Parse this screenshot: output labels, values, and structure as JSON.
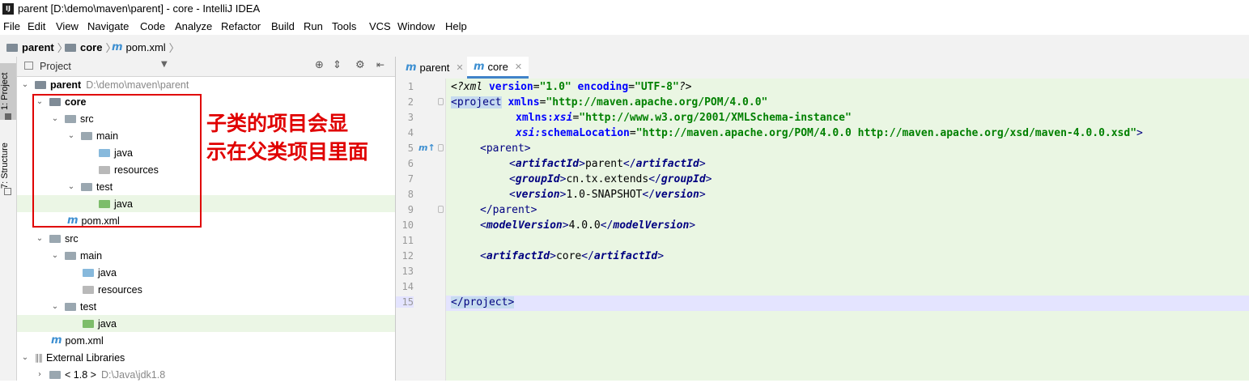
{
  "window": {
    "title": "parent [D:\\demo\\maven\\parent] - core - IntelliJ IDEA",
    "app_icon": "IJ"
  },
  "menu": [
    "File",
    "Edit",
    "View",
    "Navigate",
    "Code",
    "Analyze",
    "Refactor",
    "Build",
    "Run",
    "Tools",
    "VCS",
    "Window",
    "Help"
  ],
  "breadcrumb": {
    "items": [
      "parent",
      "core",
      "pom.xml"
    ],
    "pom_icon": "m"
  },
  "toolstrip": {
    "project_tab": "1: Project",
    "structure_tab": "7: Structure"
  },
  "project_panel": {
    "header": "Project",
    "tree": [
      {
        "label": "parent",
        "path": "D:\\demo\\maven\\parent",
        "icon": "module-folder-icon"
      },
      {
        "label": "core",
        "icon": "module-folder-icon"
      },
      {
        "label": "src",
        "icon": "folder-icon"
      },
      {
        "label": "main",
        "icon": "folder-icon"
      },
      {
        "label": "java",
        "icon": "source-folder-icon"
      },
      {
        "label": "resources",
        "icon": "resources-folder-icon"
      },
      {
        "label": "test",
        "icon": "folder-icon"
      },
      {
        "label": "java",
        "icon": "test-source-folder-icon"
      },
      {
        "label": "pom.xml",
        "icon": "maven-icon"
      },
      {
        "label": "src",
        "icon": "folder-icon"
      },
      {
        "label": "main",
        "icon": "folder-icon"
      },
      {
        "label": "java",
        "icon": "source-folder-icon"
      },
      {
        "label": "resources",
        "icon": "resources-folder-icon"
      },
      {
        "label": "test",
        "icon": "folder-icon"
      },
      {
        "label": "java",
        "icon": "test-source-folder-icon"
      },
      {
        "label": "pom.xml",
        "icon": "maven-icon"
      },
      {
        "label": "External Libraries",
        "icon": "libraries-icon"
      },
      {
        "label": "< 1.8 >",
        "path": "D:\\Java\\jdk1.8",
        "icon": "jdk-folder-icon"
      }
    ]
  },
  "annotation": {
    "line1": "子类的项目会显",
    "line2": "示在父类项目里面",
    "color": "#e00000"
  },
  "editor": {
    "tabs": [
      "parent",
      "core"
    ],
    "active_tab": "core",
    "line_numbers": [
      "1",
      "2",
      "3",
      "4",
      "5",
      "6",
      "7",
      "8",
      "9",
      "10",
      "11",
      "12",
      "13",
      "14",
      "15"
    ],
    "code": {
      "l1": {
        "open": "<?xml ",
        "a1": "version",
        "eq1": "=",
        "v1": "\"1.0\"",
        "a2": " encoding",
        "eq2": "=",
        "v2": "\"UTF-8\"",
        "close": "?>"
      },
      "l2": {
        "tag": "<project",
        "a": " xmlns",
        "eq": "=",
        "v": "\"http://maven.apache.org/POM/4.0.0\""
      },
      "l3": {
        "a": "xmlns:",
        "ai": "xsi",
        "eq": "=",
        "v": "\"http://www.w3.org/2001/XMLSchema-instance\""
      },
      "l4": {
        "ai": "xsi:",
        "a": "schemaLocation",
        "eq": "=",
        "v": "\"http://maven.apache.org/POM/4.0.0 http://maven.apache.org/xsd/maven-4.0.0.xsd\"",
        "close": ">"
      },
      "l5": {
        "tag": "<parent>"
      },
      "l6": {
        "o": "<",
        "t": "artifactId",
        "c": ">",
        "text": "parent",
        "o2": "</",
        "c2": ">"
      },
      "l7": {
        "o": "<",
        "t": "groupId",
        "c": ">",
        "text": "cn.tx.extends",
        "o2": "</",
        "c2": ">"
      },
      "l8": {
        "o": "<",
        "t": "version",
        "c": ">",
        "text": "1.0-SNAPSHOT",
        "o2": "</",
        "c2": ">"
      },
      "l9": {
        "tag": "</parent>"
      },
      "l10": {
        "o": "<",
        "t": "modelVersion",
        "c": ">",
        "text": "4.0.0",
        "o2": "</",
        "c2": ">"
      },
      "l12": {
        "o": "<",
        "t": "artifactId",
        "c": ">",
        "text": "core",
        "o2": "</",
        "c2": ">"
      },
      "l15": {
        "tag": "</project>"
      }
    },
    "gutter_marker": "m↑"
  }
}
